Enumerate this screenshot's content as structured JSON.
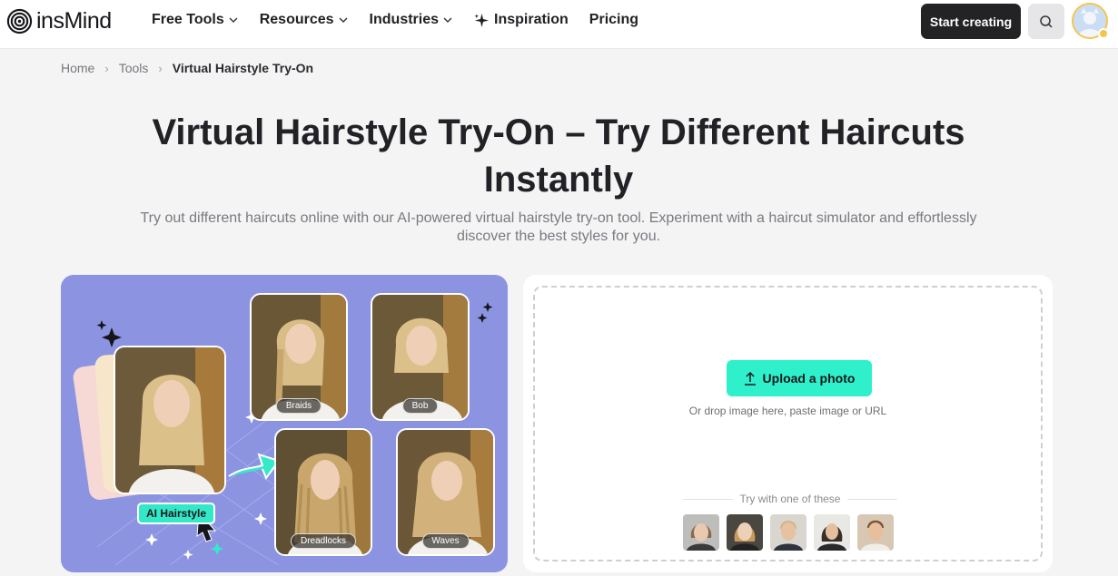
{
  "brand": {
    "name": "insMind"
  },
  "nav": {
    "items": [
      {
        "label": "Free Tools",
        "has_dropdown": true
      },
      {
        "label": "Resources",
        "has_dropdown": true
      },
      {
        "label": "Industries",
        "has_dropdown": true
      },
      {
        "label": "Inspiration",
        "icon": "sparkle-icon"
      },
      {
        "label": "Pricing"
      }
    ],
    "start_label": "Start creating",
    "search_icon": "search-icon"
  },
  "breadcrumb": [
    "Home",
    "Tools",
    "Virtual Hairstyle Try-On"
  ],
  "hero": {
    "title": "Virtual Hairstyle Try-On – Try Different Haircuts Instantly",
    "subtitle": "Try out different haircuts online with our AI-powered virtual hairstyle try-on tool. Experiment with a haircut simulator and effortlessly discover the best styles for you."
  },
  "showcase": {
    "ai_label": "AI Hairstyle",
    "styles": [
      "Braids",
      "Bob",
      "Dreadlocks",
      "Waves"
    ]
  },
  "upload": {
    "button_label": "Upload a photo",
    "hint": "Or drop image here, paste image or URL",
    "samples_label": "Try with one of these"
  },
  "colors": {
    "accent": "#2ef0cb",
    "showcase_bg": "#8c94e2",
    "primary_button": "#232326"
  }
}
